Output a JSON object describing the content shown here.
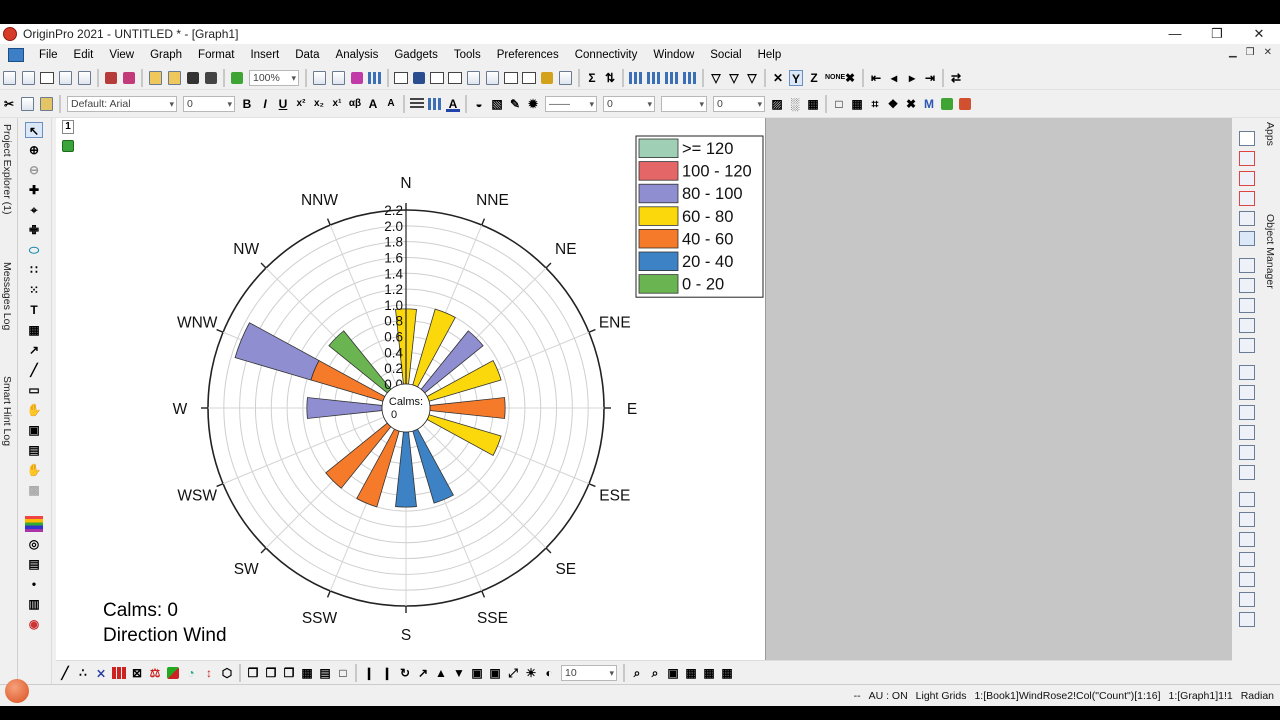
{
  "window": {
    "title": "OriginPro 2021 - UNTITLED * - [Graph1]",
    "controls": [
      "—",
      "❒",
      "✕"
    ]
  },
  "menu": [
    "File",
    "Edit",
    "View",
    "Graph",
    "Format",
    "Insert",
    "Data",
    "Analysis",
    "Gadgets",
    "Tools",
    "Preferences",
    "Connectivity",
    "Window",
    "Social",
    "Help"
  ],
  "toolbar": {
    "zoom": "100%",
    "font_name": "Default: Arial",
    "font_size": "0",
    "line_width": "0",
    "fill_size": "0",
    "point_size": "10"
  },
  "side_tabs": {
    "project_explorer": "Project Explorer (1)",
    "messages_log": "Messages Log",
    "smart_hint_log": "Smart Hint Log",
    "apps": "Apps",
    "object_manager": "Object Manager"
  },
  "layer_label": "1",
  "chart_data": {
    "type": "polar-bar",
    "title": "",
    "directions": [
      "N",
      "NNE",
      "NE",
      "ENE",
      "E",
      "ESE",
      "SE",
      "SSE",
      "S",
      "SSW",
      "SW",
      "WSW",
      "W",
      "WNW",
      "NW",
      "NNW"
    ],
    "radial_ticks": [
      "0.0",
      "0.2",
      "0.4",
      "0.6",
      "0.8",
      "1.0",
      "1.2",
      "1.4",
      "1.6",
      "1.8",
      "2.0",
      "2.2"
    ],
    "r_range": [
      0,
      2.2
    ],
    "center_label_line1": "Calms:",
    "center_label_line2": "0",
    "legend_placement": "top-right",
    "legend": [
      {
        "label": ">= 120",
        "color": "#9fd0b6"
      },
      {
        "label": "100 - 120",
        "color": "#e56666"
      },
      {
        "label": "80 - 100",
        "color": "#8f8ed0"
      },
      {
        "label": "60 - 80",
        "color": "#fbd80b"
      },
      {
        "label": "40 - 60",
        "color": "#f57b2b"
      },
      {
        "label": "20 - 40",
        "color": "#3c82c4"
      },
      {
        "label": "0 - 20",
        "color": "#6ab551"
      }
    ],
    "bars": [
      {
        "dir": "N",
        "value": 0.95,
        "bin": "60 - 80"
      },
      {
        "dir": "NNE",
        "value": 1.0,
        "bin": "60 - 80"
      },
      {
        "dir": "NE",
        "value": 0.95,
        "bin": "80 - 100"
      },
      {
        "dir": "ENE",
        "value": 0.95,
        "bin": "60 - 80"
      },
      {
        "dir": "E",
        "value": 0.95,
        "bin": "40 - 60"
      },
      {
        "dir": "ESE",
        "value": 0.95,
        "bin": "60 - 80"
      },
      {
        "dir": "SE",
        "value": 0.0,
        "bin": "60 - 80"
      },
      {
        "dir": "SSE",
        "value": 0.95,
        "bin": "20 - 40"
      },
      {
        "dir": "S",
        "value": 0.95,
        "bin": "20 - 40"
      },
      {
        "dir": "SSW",
        "value": 1.0,
        "bin": "40 - 60"
      },
      {
        "dir": "SW",
        "value": 1.0,
        "bin": "40 - 60"
      },
      {
        "dir": "WSW",
        "value": 0.0,
        "bin": "40 - 60"
      },
      {
        "dir": "W",
        "value": 0.95,
        "bin": "80 - 100"
      },
      {
        "dir": "WNW",
        "value": 0.95,
        "bin": "40 - 60",
        "stack": [
          {
            "value": 1.0,
            "bin": "80 - 100"
          }
        ]
      },
      {
        "dir": "NW",
        "value": 0.95,
        "bin": "0 - 20"
      },
      {
        "dir": "NNW",
        "value": 0.0,
        "bin": "0 - 20"
      }
    ],
    "notes": [
      "Calms: 0",
      "Direction Wind"
    ]
  },
  "status": {
    "dots": "--",
    "au": "AU : ON",
    "theme": "Light Grids",
    "source": "1:[Book1]WindRose2!Col(\"Count\")[1:16]",
    "layer": "1:[Graph1]1!1",
    "unit": "Radian"
  }
}
